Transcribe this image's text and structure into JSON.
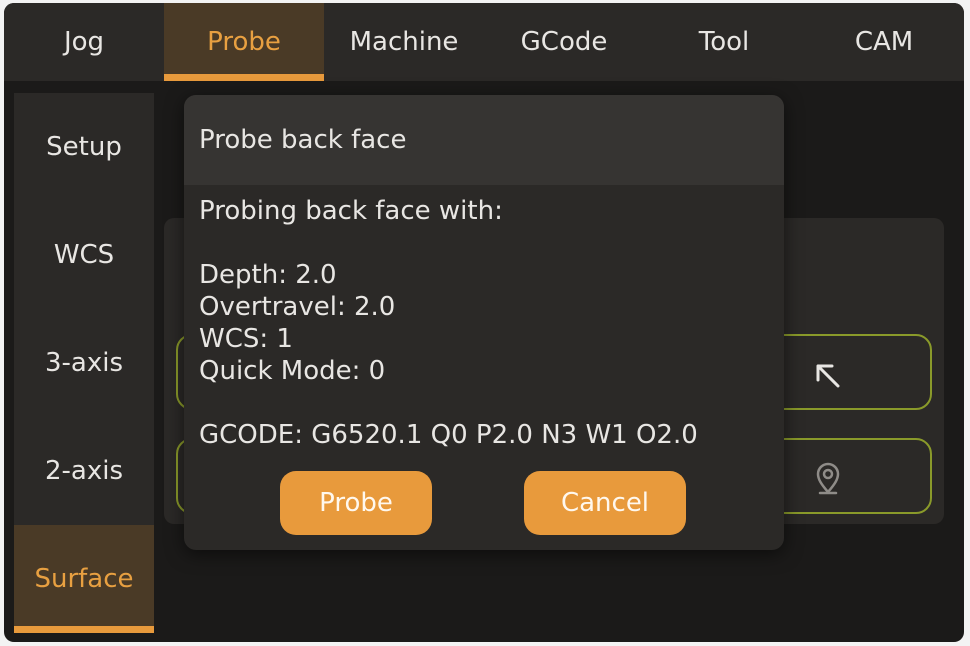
{
  "tabs": [
    {
      "label": "Jog"
    },
    {
      "label": "Probe"
    },
    {
      "label": "Machine"
    },
    {
      "label": "GCode"
    },
    {
      "label": "Tool"
    },
    {
      "label": "CAM"
    }
  ],
  "active_tab": "Probe",
  "sidenav": [
    {
      "label": "Setup"
    },
    {
      "label": "WCS"
    },
    {
      "label": "3-axis"
    },
    {
      "label": "2-axis"
    },
    {
      "label": "Surface"
    }
  ],
  "active_side": "Surface",
  "background_buttons": [
    {
      "icon": "arrow-up-left-icon"
    },
    {
      "icon": "map-pin-icon"
    }
  ],
  "dialog": {
    "title": "Probe back face",
    "intro": "Probing back face with:",
    "params": [
      "Depth: 2.0",
      "Overtravel: 2.0",
      "WCS: 1",
      "Quick Mode: 0"
    ],
    "gcode": "GCODE: G6520.1 Q0 P2.0 N3 W1 O2.0",
    "probe_label": "Probe",
    "cancel_label": "Cancel"
  },
  "colors": {
    "accent": "#e89a3c",
    "background": "#1b1a19",
    "panel": "#2b2927",
    "active_tab_bg": "#4a3a26",
    "outline": "#8a9a2a"
  }
}
